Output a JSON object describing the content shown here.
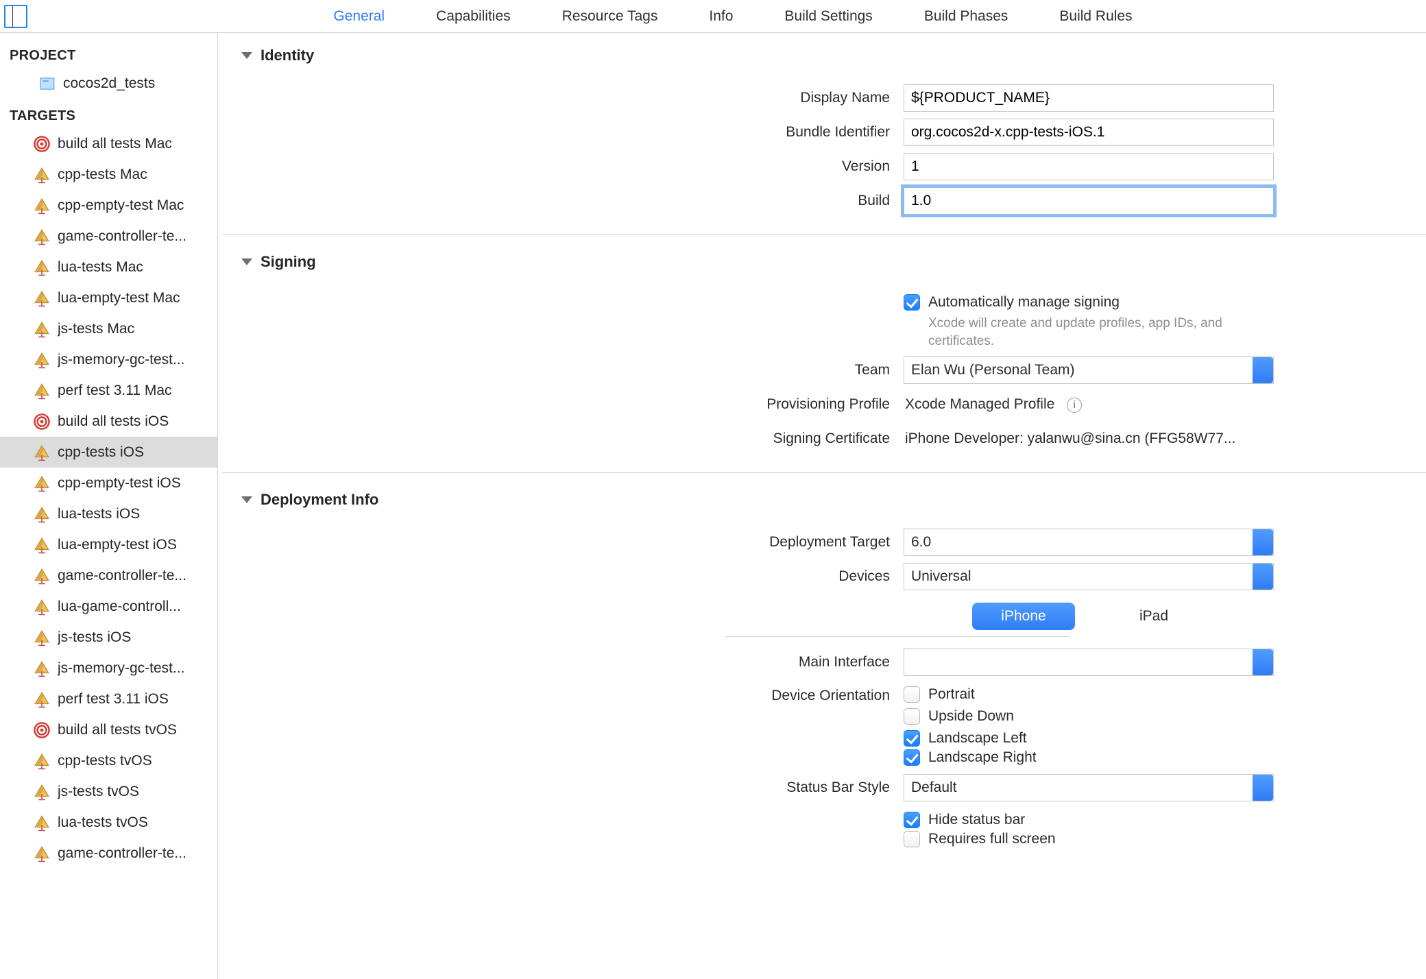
{
  "tabs": {
    "general": "General",
    "capabilities": "Capabilities",
    "resource_tags": "Resource Tags",
    "info": "Info",
    "build_settings": "Build Settings",
    "build_phases": "Build Phases",
    "build_rules": "Build Rules"
  },
  "sidebar": {
    "project_header": "PROJECT",
    "project": "cocos2d_tests",
    "targets_header": "TARGETS",
    "targets": [
      {
        "label": "build all tests Mac",
        "icon": "target"
      },
      {
        "label": "cpp-tests Mac",
        "icon": "app"
      },
      {
        "label": "cpp-empty-test Mac",
        "icon": "app"
      },
      {
        "label": "game-controller-te...",
        "icon": "app"
      },
      {
        "label": "lua-tests Mac",
        "icon": "app"
      },
      {
        "label": "lua-empty-test Mac",
        "icon": "app"
      },
      {
        "label": "js-tests Mac",
        "icon": "app"
      },
      {
        "label": "js-memory-gc-test...",
        "icon": "app"
      },
      {
        "label": "perf test 3.11 Mac",
        "icon": "app"
      },
      {
        "label": "build all tests iOS",
        "icon": "target"
      },
      {
        "label": "cpp-tests iOS",
        "icon": "app",
        "selected": true
      },
      {
        "label": "cpp-empty-test iOS",
        "icon": "app"
      },
      {
        "label": "lua-tests iOS",
        "icon": "app"
      },
      {
        "label": "lua-empty-test iOS",
        "icon": "app"
      },
      {
        "label": "game-controller-te...",
        "icon": "app"
      },
      {
        "label": "lua-game-controll...",
        "icon": "app"
      },
      {
        "label": "js-tests iOS",
        "icon": "app"
      },
      {
        "label": "js-memory-gc-test...",
        "icon": "app"
      },
      {
        "label": "perf test 3.11 iOS",
        "icon": "app"
      },
      {
        "label": "build all tests tvOS",
        "icon": "target"
      },
      {
        "label": "cpp-tests tvOS",
        "icon": "app"
      },
      {
        "label": "js-tests tvOS",
        "icon": "app"
      },
      {
        "label": "lua-tests tvOS",
        "icon": "app"
      },
      {
        "label": "game-controller-te...",
        "icon": "app"
      }
    ]
  },
  "sections": {
    "identity": "Identity",
    "signing": "Signing",
    "deployment": "Deployment Info"
  },
  "identity": {
    "display_name_lbl": "Display Name",
    "display_name": "${PRODUCT_NAME}",
    "bundle_id_lbl": "Bundle Identifier",
    "bundle_id": "org.cocos2d-x.cpp-tests-iOS.1",
    "version_lbl": "Version",
    "version": "1",
    "build_lbl": "Build",
    "build": "1.0"
  },
  "signing": {
    "auto_label": "Automatically manage signing",
    "auto_hint": "Xcode will create and update profiles, app IDs, and certificates.",
    "team_lbl": "Team",
    "team": "Elan Wu (Personal Team)",
    "profile_lbl": "Provisioning Profile",
    "profile": "Xcode Managed Profile",
    "cert_lbl": "Signing Certificate",
    "cert": "iPhone Developer: yalanwu@sina.cn (FFG58W77..."
  },
  "deployment": {
    "target_lbl": "Deployment Target",
    "target": "6.0",
    "devices_lbl": "Devices",
    "devices": "Universal",
    "seg_iphone": "iPhone",
    "seg_ipad": "iPad",
    "main_if_lbl": "Main Interface",
    "main_if": "",
    "orientation_lbl": "Device Orientation",
    "orient": {
      "portrait": "Portrait",
      "upside": "Upside Down",
      "land_l": "Landscape Left",
      "land_r": "Landscape Right"
    },
    "statusbar_lbl": "Status Bar Style",
    "statusbar": "Default",
    "hide_lbl": "Hide status bar",
    "fullscreen_lbl": "Requires full screen"
  }
}
